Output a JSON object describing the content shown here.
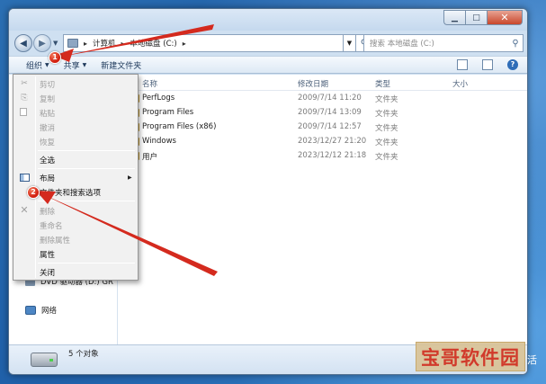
{
  "window": {
    "address_crumbs": [
      "计算机",
      "本地磁盘 (C:)"
    ],
    "search_placeholder": "搜索 本地磁盘 (C:)",
    "caption": {
      "minimize": "▁",
      "maximize": "□",
      "close": "✕"
    }
  },
  "toolbar": {
    "organize_label": "组织",
    "share_label": "共享",
    "new_folder_label": "新建文件夹"
  },
  "columns": {
    "name": "名称",
    "modified": "修改日期",
    "type": "类型",
    "size": "大小"
  },
  "files": [
    {
      "name": "PerfLogs",
      "date": "2009/7/14 11:20",
      "type": "文件夹"
    },
    {
      "name": "Program Files",
      "date": "2009/7/14 13:09",
      "type": "文件夹"
    },
    {
      "name": "Program Files (x86)",
      "date": "2009/7/14 12:57",
      "type": "文件夹"
    },
    {
      "name": "Windows",
      "date": "2023/12/27 21:20",
      "type": "文件夹"
    },
    {
      "name": "用户",
      "date": "2023/12/12 21:18",
      "type": "文件夹"
    }
  ],
  "navpane": {
    "dvd_label": "DVD 驱动器 (D:) GR",
    "network_label": "网络"
  },
  "menu": {
    "items": [
      {
        "label": "剪切",
        "enabled": false
      },
      {
        "label": "复制",
        "enabled": false
      },
      {
        "label": "粘贴",
        "enabled": false
      },
      {
        "label": "撤消",
        "enabled": false
      },
      {
        "label": "恢复",
        "enabled": false
      },
      {
        "label": "全选",
        "enabled": true
      },
      {
        "label": "布局",
        "enabled": true
      },
      {
        "label": "文件夹和搜索选项",
        "enabled": true
      },
      {
        "label": "删除",
        "enabled": false
      },
      {
        "label": "重命名",
        "enabled": false
      },
      {
        "label": "删除属性",
        "enabled": false
      },
      {
        "label": "属性",
        "enabled": true
      },
      {
        "label": "关闭",
        "enabled": true
      }
    ]
  },
  "status": {
    "item_count": "5 个对象"
  },
  "annotations": {
    "badge_1": "1",
    "badge_2": "2",
    "arrow_color": "#d42a1e"
  },
  "watermark": {
    "text": "宝哥软件园",
    "tail": "活"
  }
}
